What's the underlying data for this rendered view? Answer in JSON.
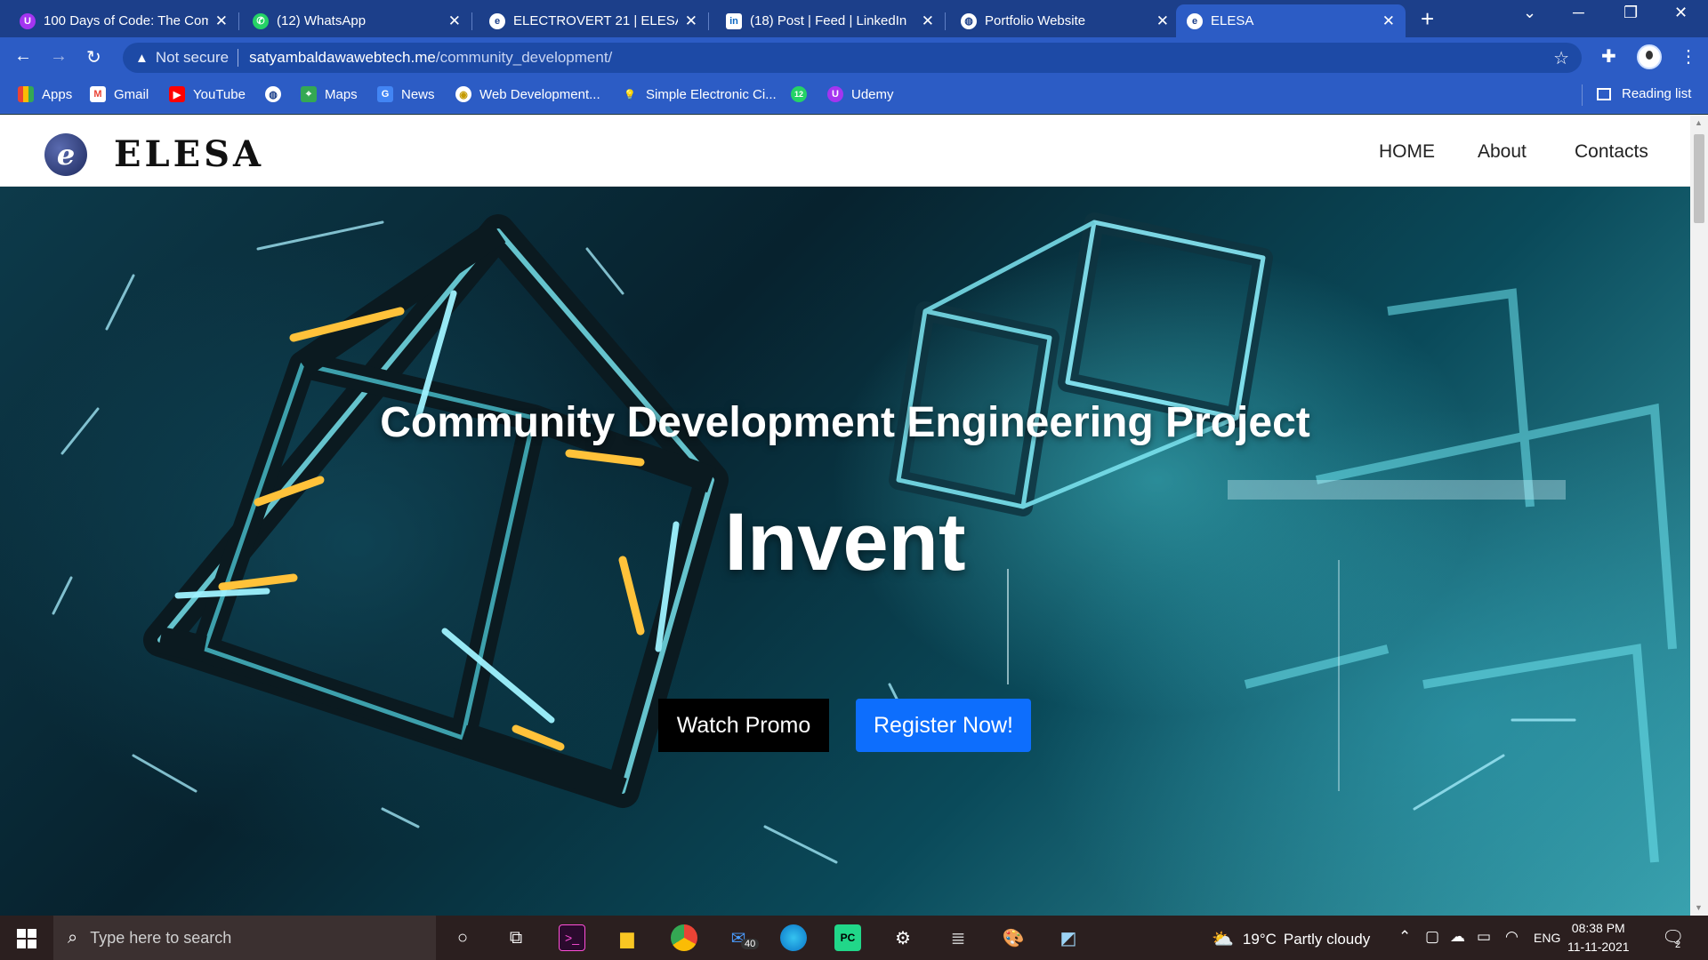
{
  "browser": {
    "tabs": [
      {
        "title": "100 Days of Code: The Com",
        "icon": "udemy-icon",
        "color": "#a435f0"
      },
      {
        "title": "(12) WhatsApp",
        "icon": "whatsapp-icon",
        "color": "#25d366"
      },
      {
        "title": "ELECTROVERT 21 | ELESA",
        "icon": "elesa-icon",
        "color": "#ffffff"
      },
      {
        "title": "(18) Post | Feed | LinkedIn",
        "icon": "linkedin-icon",
        "color": "#0a66c2"
      },
      {
        "title": "Portfolio Website",
        "icon": "globe-icon",
        "color": "#ffffff"
      },
      {
        "title": "ELESA",
        "icon": "elesa-icon",
        "color": "#ffffff"
      }
    ],
    "active_tab": 5,
    "address": {
      "security": "Not secure",
      "host": "satyambaldawawebtech.me",
      "path": "/community_development/"
    },
    "bookmarks": [
      {
        "label": "Apps",
        "icon": "apps-grid-icon"
      },
      {
        "label": "Gmail",
        "icon": "gmail-icon"
      },
      {
        "label": "YouTube",
        "icon": "youtube-icon"
      },
      {
        "label": "",
        "icon": "globe-icon"
      },
      {
        "label": "Maps",
        "icon": "maps-icon"
      },
      {
        "label": "News",
        "icon": "news-icon"
      },
      {
        "label": "Web Development...",
        "icon": "web-dev-icon"
      },
      {
        "label": "Simple Electronic Ci...",
        "icon": "bulb-icon"
      },
      {
        "label": "",
        "icon": "whatsapp-icon"
      },
      {
        "label": "Udemy",
        "icon": "udemy-icon"
      }
    ],
    "reading_list": "Reading list",
    "whatsapp_badge": "12"
  },
  "site": {
    "logo_text": "ELESA",
    "logo_mark": "e",
    "nav": [
      "HOME",
      "About",
      "Contacts"
    ],
    "hero_title": "Community Development Engineering Project",
    "hero_word": "Invent",
    "buttons": {
      "promo": "Watch Promo",
      "register": "Register Now!"
    },
    "colors": {
      "register": "#0d6efd",
      "promo": "#000000"
    }
  },
  "taskbar": {
    "search_placeholder": "Type here to search",
    "mail_badge": "40",
    "weather": {
      "temp": "19°C",
      "desc": "Partly cloudy"
    },
    "lang": "ENG",
    "time": "08:38 PM",
    "date": "11-11-2021",
    "notifications": "2"
  }
}
